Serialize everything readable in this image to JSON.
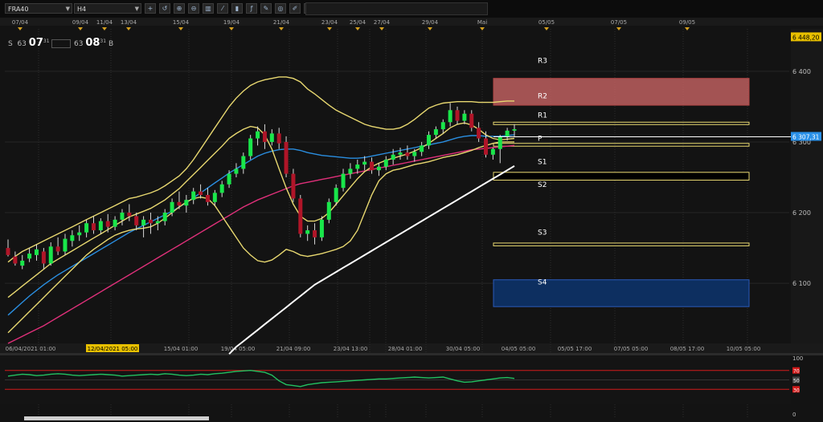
{
  "toolbar": {
    "symbol": "FRA40",
    "timeframe": "H4",
    "icons": [
      "crosshair-icon",
      "reset-icon",
      "zoom-in-icon",
      "zoom-out-icon",
      "bar-chart-icon",
      "line-chart-icon",
      "candle-icon",
      "indicator-icon",
      "draw-icon",
      "globe-icon",
      "pencil-icon",
      "text-icon",
      "levels-icon",
      "grid-icon",
      "refresh-icon",
      "window-icon",
      "settings-icon",
      "list-icon"
    ]
  },
  "clock": {
    "left_prefix": "S",
    "left_num": "63",
    "left_time": "07",
    "left_sec": "31",
    "right_num": "63",
    "right_time": "08",
    "right_sec": "31",
    "right_suffix": "B"
  },
  "chart_data": {
    "type": "candlestick",
    "symbol": "FRA40",
    "timeframe": "H4",
    "ylim": [
      6015,
      6460
    ],
    "y_ticks": [
      6100,
      6200,
      6300,
      6400
    ],
    "y_tick_labels": [
      "6 100",
      "6 200",
      "6 300",
      "6 400"
    ],
    "top_date_labels": [
      "07/04",
      "09/04",
      "11/04",
      "13/04",
      "15/04",
      "19/04",
      "21/04",
      "23/04",
      "25/04",
      "27/04",
      "29/04",
      "Mai",
      "05/05",
      "07/05",
      "09/05"
    ],
    "bottom_date_labels": [
      "06/04/2021 01:00",
      "12/04/2021 05:00",
      "15/04 01:00",
      "19/04 05:00",
      "21/04 09:00",
      "23/04 13:00",
      "28/04 01:00",
      "30/04 05:00",
      "04/05 05:00",
      "05/05 17:00",
      "07/05 05:00",
      "08/05 17:00",
      "10/05 05:00"
    ],
    "highlighted_date": "12/04/2021 05:00",
    "price_tag_top": "6 448,20",
    "price_tag_last": "6 307,31",
    "last_price": 6307.31,
    "candles": [
      [
        6150,
        6162,
        6140,
        6138
      ],
      [
        6138,
        6145,
        6128,
        6125
      ],
      [
        6125,
        6140,
        6132,
        6120
      ],
      [
        6135,
        6150,
        6142,
        6130
      ],
      [
        6140,
        6155,
        6148,
        6132
      ],
      [
        6145,
        6150,
        6128,
        6120
      ],
      [
        6128,
        6158,
        6152,
        6125
      ],
      [
        6152,
        6165,
        6145,
        6140
      ],
      [
        6145,
        6170,
        6163,
        6140
      ],
      [
        6160,
        6175,
        6168,
        6152
      ],
      [
        6168,
        6182,
        6172,
        6160
      ],
      [
        6172,
        6190,
        6185,
        6165
      ],
      [
        6185,
        6195,
        6175,
        6170
      ],
      [
        6175,
        6192,
        6188,
        6170
      ],
      [
        6188,
        6198,
        6180,
        6172
      ],
      [
        6180,
        6195,
        6190,
        6175
      ],
      [
        6190,
        6205,
        6200,
        6182
      ],
      [
        6200,
        6212,
        6195,
        6188
      ],
      [
        6195,
        6200,
        6182,
        6175
      ],
      [
        6182,
        6195,
        6190,
        6165
      ],
      [
        6190,
        6200,
        6185,
        6170
      ],
      [
        6185,
        6195,
        6188,
        6175
      ],
      [
        6188,
        6205,
        6200,
        6182
      ],
      [
        6200,
        6220,
        6215,
        6195
      ],
      [
        6215,
        6230,
        6210,
        6205
      ],
      [
        6210,
        6225,
        6218,
        6200
      ],
      [
        6218,
        6235,
        6230,
        6212
      ],
      [
        6230,
        6240,
        6225,
        6220
      ],
      [
        6225,
        6235,
        6215,
        6210
      ],
      [
        6215,
        6232,
        6228,
        6210
      ],
      [
        6228,
        6245,
        6240,
        6222
      ],
      [
        6240,
        6260,
        6255,
        6235
      ],
      [
        6255,
        6270,
        6262,
        6250
      ],
      [
        6262,
        6285,
        6280,
        6255
      ],
      [
        6280,
        6310,
        6305,
        6275
      ],
      [
        6305,
        6322,
        6315,
        6295
      ],
      [
        6315,
        6325,
        6300,
        6290
      ],
      [
        6300,
        6318,
        6312,
        6295
      ],
      [
        6312,
        6320,
        6298,
        6290
      ],
      [
        6300,
        6308,
        6255,
        6250
      ],
      [
        6255,
        6262,
        6220,
        6215
      ],
      [
        6220,
        6225,
        6170,
        6165
      ],
      [
        6170,
        6182,
        6175,
        6160
      ],
      [
        6175,
        6185,
        6165,
        6155
      ],
      [
        6165,
        6195,
        6190,
        6160
      ],
      [
        6190,
        6220,
        6215,
        6185
      ],
      [
        6215,
        6240,
        6235,
        6210
      ],
      [
        6235,
        6262,
        6255,
        6230
      ],
      [
        6255,
        6270,
        6262,
        6248
      ],
      [
        6262,
        6275,
        6268,
        6255
      ],
      [
        6268,
        6280,
        6272,
        6260
      ],
      [
        6272,
        6278,
        6260,
        6255
      ],
      [
        6260,
        6270,
        6265,
        6252
      ],
      [
        6265,
        6280,
        6275,
        6260
      ],
      [
        6275,
        6290,
        6282,
        6268
      ],
      [
        6282,
        6292,
        6285,
        6275
      ],
      [
        6285,
        6295,
        6280,
        6275
      ],
      [
        6280,
        6290,
        6286,
        6272
      ],
      [
        6286,
        6300,
        6295,
        6280
      ],
      [
        6295,
        6315,
        6310,
        6290
      ],
      [
        6310,
        6322,
        6318,
        6305
      ],
      [
        6318,
        6332,
        6328,
        6312
      ],
      [
        6328,
        6355,
        6345,
        6322
      ],
      [
        6345,
        6350,
        6330,
        6325
      ],
      [
        6330,
        6345,
        6340,
        6325
      ],
      [
        6340,
        6345,
        6320,
        6315
      ],
      [
        6320,
        6328,
        6305,
        6300
      ],
      [
        6305,
        6315,
        6282,
        6278
      ],
      [
        6282,
        6292,
        6290,
        6275
      ],
      [
        6290,
        6310,
        6308,
        6270
      ],
      [
        6308,
        6320,
        6316,
        6302
      ],
      [
        6316,
        6325,
        6318,
        6308
      ]
    ],
    "series": [
      {
        "name": "MA fast",
        "color": "#2a8ee0",
        "values": [
          6055,
          6064,
          6073,
          6082,
          6090,
          6098,
          6105,
          6112,
          6118,
          6124,
          6130,
          6136,
          6142,
          6148,
          6154,
          6160,
          6166,
          6172,
          6177,
          6182,
          6187,
          6192,
          6197,
          6202,
          6208,
          6214,
          6221,
          6228,
          6235,
          6242,
          6249,
          6256,
          6262,
          6268,
          6274,
          6280,
          6284,
          6287,
          6289,
          6290,
          6290,
          6288,
          6285,
          6283,
          6281,
          6280,
          6279,
          6278,
          6277,
          6277,
          6278,
          6280,
          6282,
          6284,
          6286,
          6288,
          6290,
          6292,
          6294,
          6296,
          6298,
          6300,
          6303,
          6306,
          6308,
          6309,
          6309,
          6308,
          6308,
          6308,
          6309,
          6310
        ]
      },
      {
        "name": "MA mid",
        "color": "#e0307a",
        "values": [
          6015,
          6020,
          6025,
          6030,
          6035,
          6040,
          6046,
          6052,
          6058,
          6064,
          6070,
          6076,
          6082,
          6088,
          6094,
          6100,
          6106,
          6112,
          6118,
          6124,
          6130,
          6136,
          6142,
          6148,
          6154,
          6160,
          6166,
          6172,
          6178,
          6184,
          6190,
          6196,
          6202,
          6208,
          6213,
          6218,
          6222,
          6226,
          6230,
          6234,
          6238,
          6241,
          6243,
          6245,
          6247,
          6249,
          6251,
          6253,
          6255,
          6257,
          6259,
          6261,
          6263,
          6265,
          6267,
          6269,
          6271,
          6273,
          6275,
          6277,
          6279,
          6281,
          6283,
          6285,
          6287,
          6289,
          6290,
          6291,
          6292,
          6293,
          6294,
          6295
        ]
      },
      {
        "name": "MA slow",
        "color": "#ffffff",
        "values": [
          null,
          null,
          null,
          null,
          null,
          null,
          null,
          null,
          null,
          null,
          null,
          null,
          null,
          null,
          null,
          null,
          null,
          null,
          null,
          null,
          null,
          null,
          null,
          null,
          null,
          null,
          null,
          null,
          null,
          null,
          null,
          6000,
          6010,
          6018,
          6026,
          6034,
          6042,
          6050,
          6058,
          6066,
          6074,
          6082,
          6090,
          6098,
          6104,
          6110,
          6116,
          6122,
          6128,
          6134,
          6140,
          6146,
          6152,
          6158,
          6164,
          6170,
          6176,
          6182,
          6188,
          6194,
          6200,
          6206,
          6212,
          6218,
          6224,
          6230,
          6236,
          6242,
          6248,
          6254,
          6260,
          6266
        ]
      },
      {
        "name": "BB upper",
        "color": "#e8d870",
        "values": [
          6130,
          6138,
          6145,
          6150,
          6155,
          6160,
          6165,
          6170,
          6175,
          6180,
          6185,
          6190,
          6195,
          6200,
          6205,
          6210,
          6215,
          6220,
          6222,
          6225,
          6228,
          6232,
          6238,
          6245,
          6252,
          6262,
          6275,
          6290,
          6305,
          6320,
          6335,
          6350,
          6362,
          6372,
          6380,
          6385,
          6388,
          6390,
          6392,
          6392,
          6390,
          6385,
          6375,
          6368,
          6360,
          6352,
          6345,
          6340,
          6335,
          6330,
          6325,
          6322,
          6320,
          6318,
          6318,
          6320,
          6325,
          6332,
          6340,
          6348,
          6352,
          6355,
          6356,
          6357,
          6357,
          6357,
          6356,
          6356,
          6356,
          6357,
          6358,
          6358
        ]
      },
      {
        "name": "BB lower",
        "color": "#e8d870",
        "values": [
          6030,
          6040,
          6050,
          6060,
          6070,
          6080,
          6090,
          6100,
          6110,
          6120,
          6130,
          6140,
          6148,
          6155,
          6162,
          6168,
          6172,
          6175,
          6177,
          6178,
          6180,
          6185,
          6192,
          6200,
          6208,
          6215,
          6220,
          6222,
          6220,
          6210,
          6195,
          6180,
          6165,
          6150,
          6140,
          6132,
          6130,
          6133,
          6140,
          6148,
          6145,
          6140,
          6138,
          6140,
          6142,
          6145,
          6148,
          6152,
          6160,
          6175,
          6200,
          6225,
          6245,
          6255,
          6260,
          6262,
          6265,
          6268,
          6270,
          6272,
          6275,
          6278,
          6280,
          6282,
          6285,
          6288,
          6292,
          6295,
          6298,
          6300,
          6300,
          6300
        ]
      },
      {
        "name": "BB mid",
        "color": "#e8d870",
        "values": [
          6080,
          6088,
          6096,
          6104,
          6112,
          6120,
          6128,
          6134,
          6140,
          6146,
          6152,
          6158,
          6164,
          6170,
          6176,
          6182,
          6188,
          6194,
          6198,
          6202,
          6206,
          6212,
          6218,
          6226,
          6234,
          6244,
          6254,
          6264,
          6274,
          6284,
          6294,
          6305,
          6312,
          6318,
          6322,
          6320,
          6310,
          6290,
          6262,
          6235,
          6212,
          6195,
          6188,
          6188,
          6192,
          6200,
          6212,
          6224,
          6236,
          6248,
          6258,
          6265,
          6270,
          6274,
          6277,
          6280,
          6283,
          6287,
          6292,
          6298,
          6305,
          6312,
          6320,
          6325,
          6327,
          6324,
          6318,
          6310,
          6305,
          6303,
          6304,
          6305
        ]
      }
    ],
    "pivot_levels": [
      {
        "label": "R3",
        "price": 6415,
        "color": "#ffffff",
        "box": false
      },
      {
        "label": "R2",
        "price": 6365,
        "color": "#e06060",
        "box": true,
        "top": 6390,
        "bottom": 6352
      },
      {
        "label": "R1",
        "price": 6338,
        "color": "#e8d870",
        "box": true,
        "top": 6328,
        "bottom": 6325
      },
      {
        "label": "P",
        "price": 6305,
        "color": "#e8d870",
        "box": true,
        "top": 6298,
        "bottom": 6294
      },
      {
        "label": "S1",
        "price": 6272,
        "color": "#e8d870",
        "box": true,
        "top": 6257,
        "bottom": 6246
      },
      {
        "label": "S2",
        "price": 6240,
        "color": "#ffffff",
        "box": false
      },
      {
        "label": "S3",
        "price": 6172,
        "color": "#e8d870",
        "box": true,
        "top": 6157,
        "bottom": 6153
      },
      {
        "label": "S4",
        "price": 6102,
        "color": "#2a5ab8",
        "box": true,
        "top": 6105,
        "bottom": 6067
      }
    ],
    "oscillator": {
      "ylim": [
        0,
        100
      ],
      "levels": [
        70,
        50,
        30
      ],
      "level_labels": [
        "70",
        "50",
        "30"
      ],
      "top_label": "100",
      "bottom_label": "0",
      "values": [
        58,
        60,
        62,
        61,
        59,
        60,
        62,
        63,
        62,
        60,
        59,
        60,
        61,
        62,
        61,
        60,
        58,
        59,
        60,
        61,
        62,
        61,
        63,
        62,
        60,
        59,
        60,
        62,
        61,
        63,
        64,
        66,
        68,
        69,
        70,
        68,
        66,
        60,
        48,
        40,
        38,
        36,
        40,
        42,
        44,
        45,
        46,
        47,
        48,
        49,
        50,
        51,
        52,
        52,
        53,
        54,
        55,
        56,
        55,
        54,
        55,
        56,
        52,
        48,
        45,
        46,
        48,
        50,
        52,
        54,
        55,
        53
      ]
    }
  }
}
